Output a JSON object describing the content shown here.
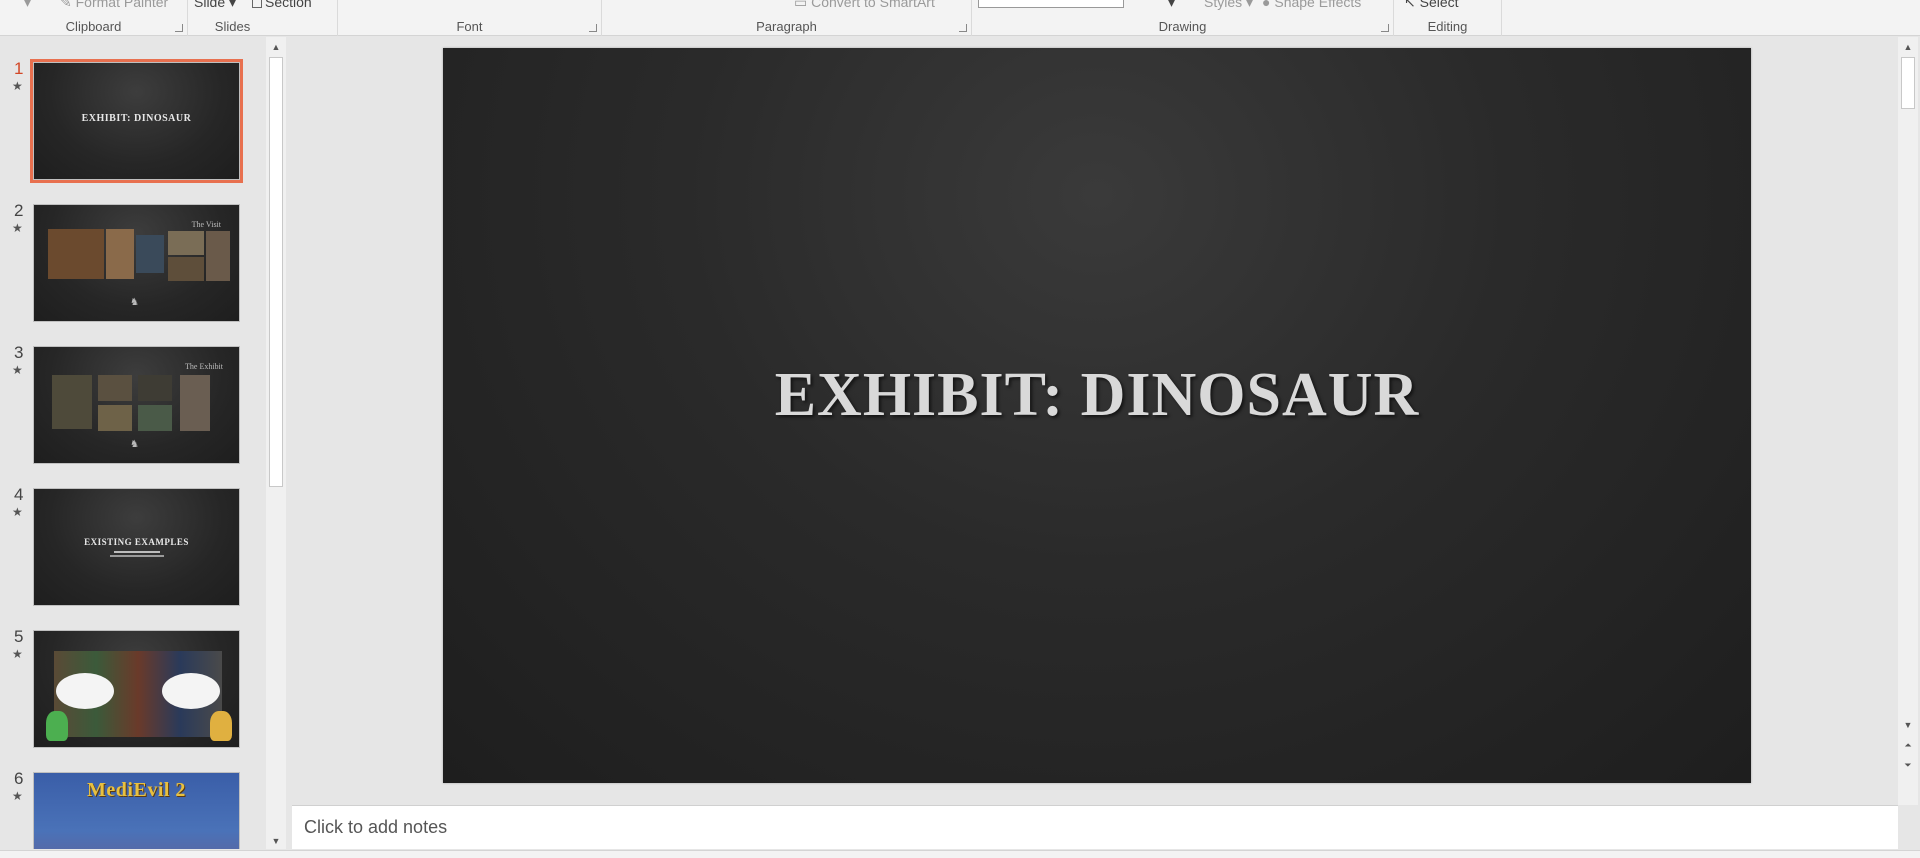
{
  "ribbon": {
    "clipboard": {
      "label": "Clipboard",
      "format_painter": "Format Painter"
    },
    "slides": {
      "label": "Slides",
      "slide_btn": "Slide",
      "section_btn": "Section"
    },
    "font": {
      "label": "Font"
    },
    "paragraph": {
      "label": "Paragraph",
      "convert_smartart": "Convert to SmartArt"
    },
    "drawing": {
      "label": "Drawing",
      "styles": "Styles",
      "shape_effects": "Shape Effects"
    },
    "editing": {
      "label": "Editing",
      "select": "Select"
    }
  },
  "thumbnails": [
    {
      "number": "1",
      "title": "EXHIBIT: DINOSAUR",
      "active": true
    },
    {
      "number": "2",
      "title": "The Visit"
    },
    {
      "number": "3",
      "title": "The Exhibit"
    },
    {
      "number": "4",
      "title": "EXISTING EXAMPLES"
    },
    {
      "number": "5",
      "title": ""
    },
    {
      "number": "6",
      "title": "MediEvil 2"
    }
  ],
  "slide": {
    "title": "EXHIBIT: DINOSAUR"
  },
  "notes": {
    "placeholder": "Click to add notes"
  },
  "colors": {
    "accent": "#d24726",
    "selection": "#e8704f",
    "slide_bg": "#262626"
  }
}
